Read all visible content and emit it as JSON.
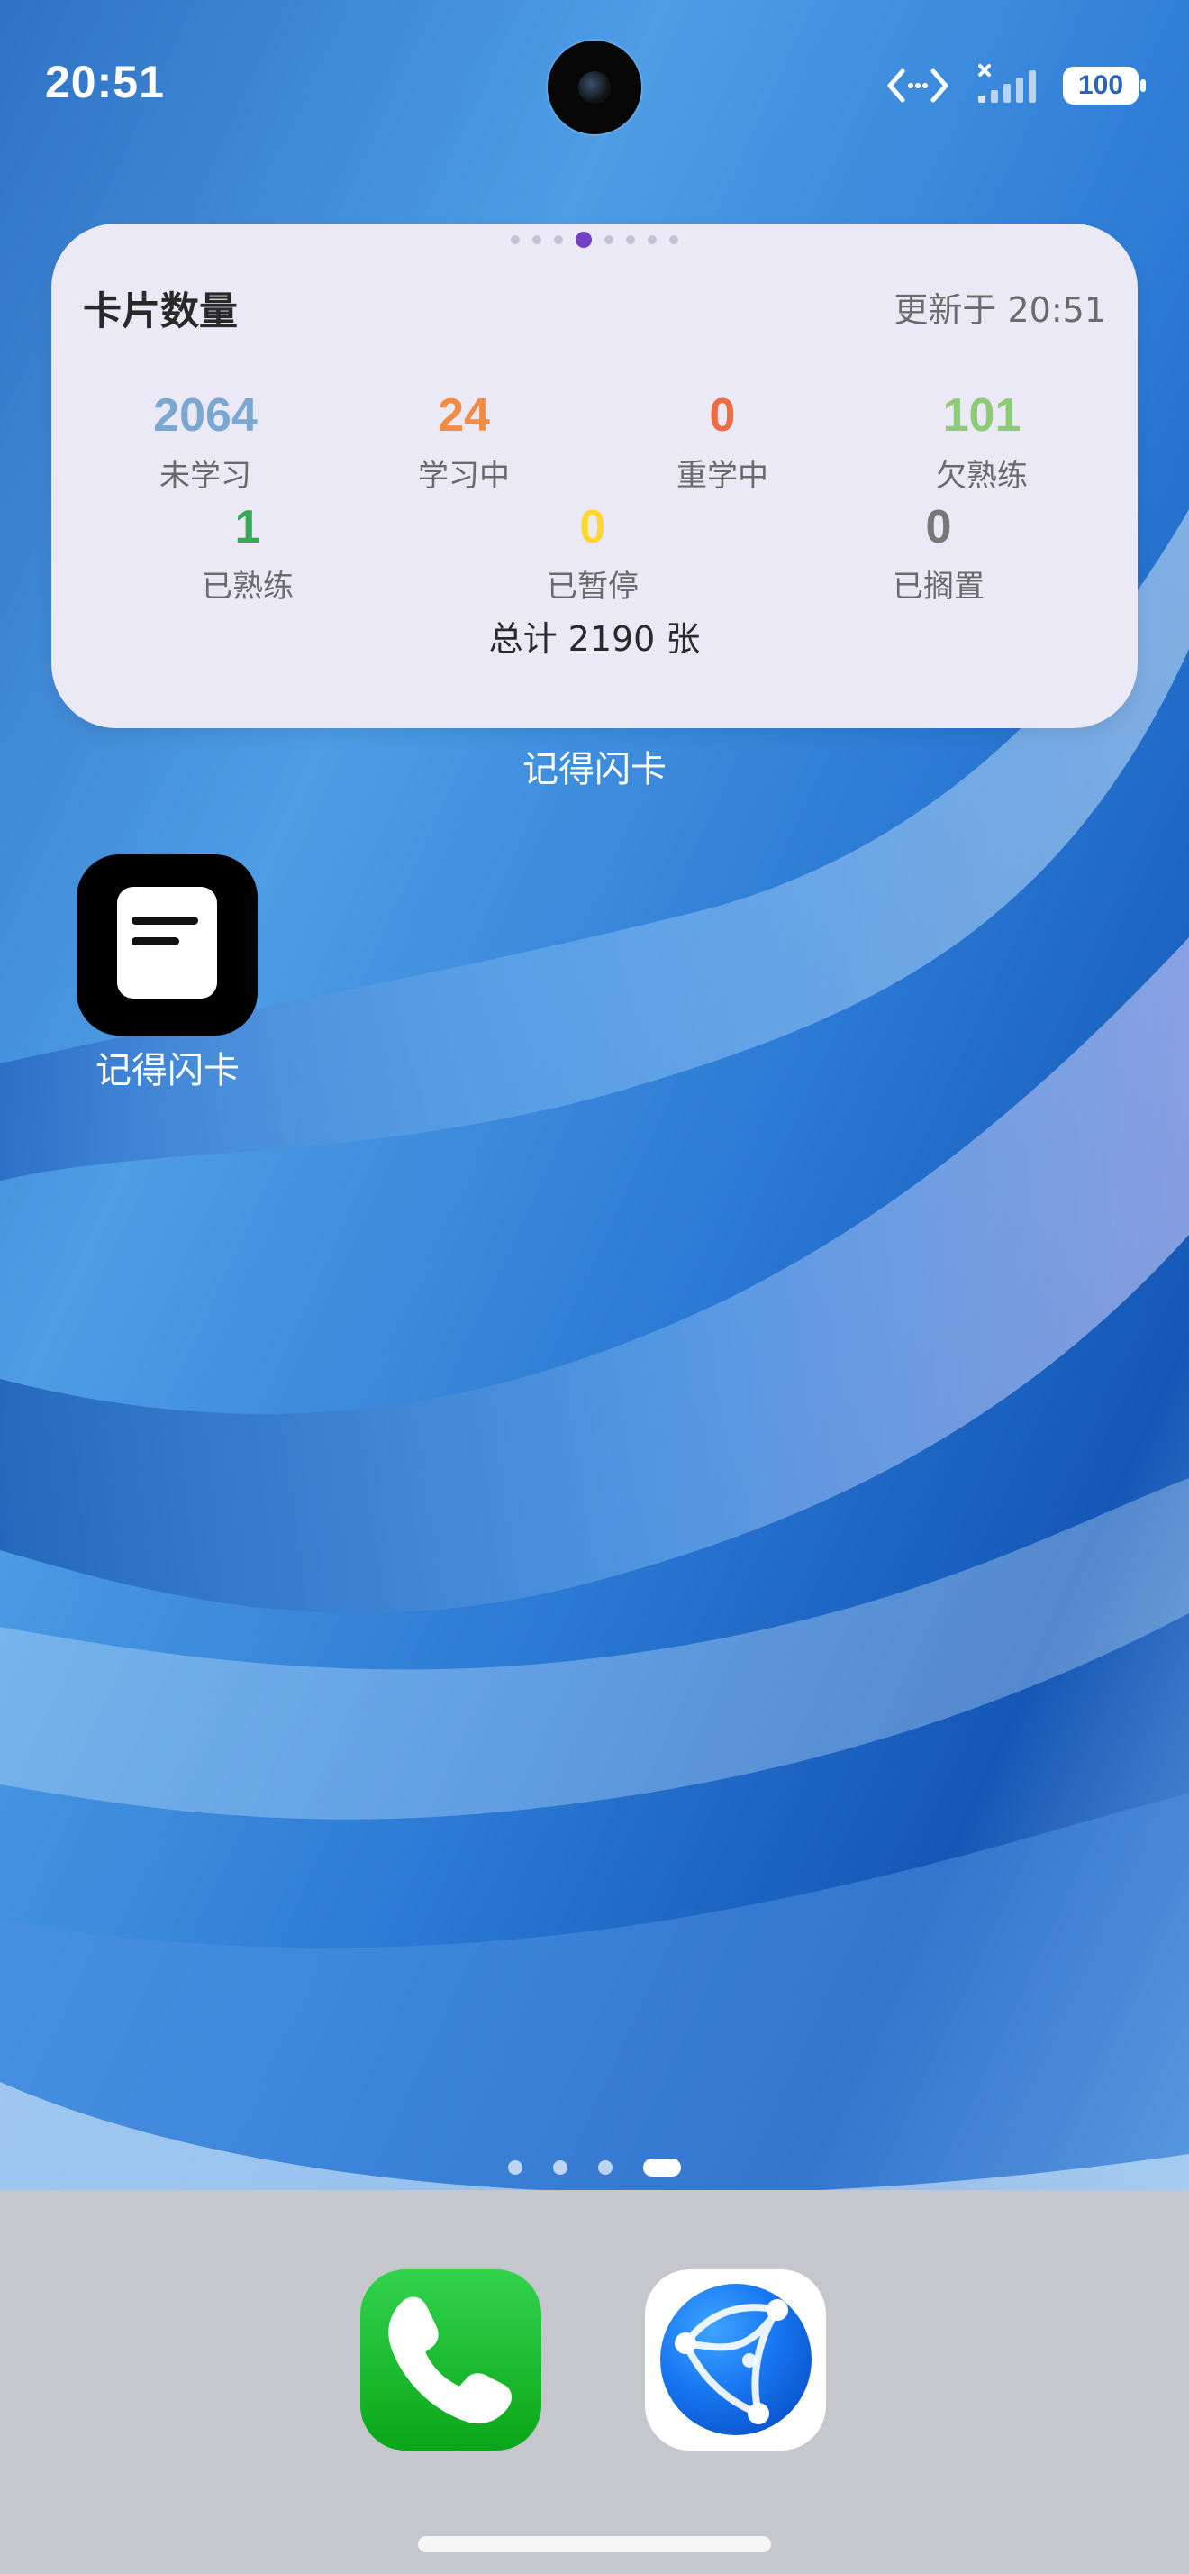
{
  "status_bar": {
    "time": "20:51",
    "battery_level": "100",
    "icons": [
      "data-transfer-icon",
      "no-signal-icon",
      "battery-icon"
    ]
  },
  "widget": {
    "title": "卡片数量",
    "updated_text": "更新于 20:51",
    "stats": [
      {
        "value": "2064",
        "label": "未学习",
        "color": "#7aa8d1"
      },
      {
        "value": "24",
        "label": "学习中",
        "color": "#f08c45"
      },
      {
        "value": "0",
        "label": "重学中",
        "color": "#ee6b44"
      },
      {
        "value": "101",
        "label": "欠熟练",
        "color": "#8ccc75"
      },
      {
        "value": "1",
        "label": "已熟练",
        "color": "#34a853"
      },
      {
        "value": "0",
        "label": "已暂停",
        "color": "#ffd72e"
      },
      {
        "value": "0",
        "label": "已搁置",
        "color": "#777777"
      }
    ],
    "total": "总计 2190 张",
    "caption": "记得闪卡"
  },
  "app": {
    "label": "记得闪卡",
    "icon": "flashcard-note-icon"
  },
  "dock": {
    "apps": [
      {
        "name": "phone",
        "icon": "phone-icon"
      },
      {
        "name": "browser",
        "icon": "network-globe-icon"
      }
    ]
  }
}
